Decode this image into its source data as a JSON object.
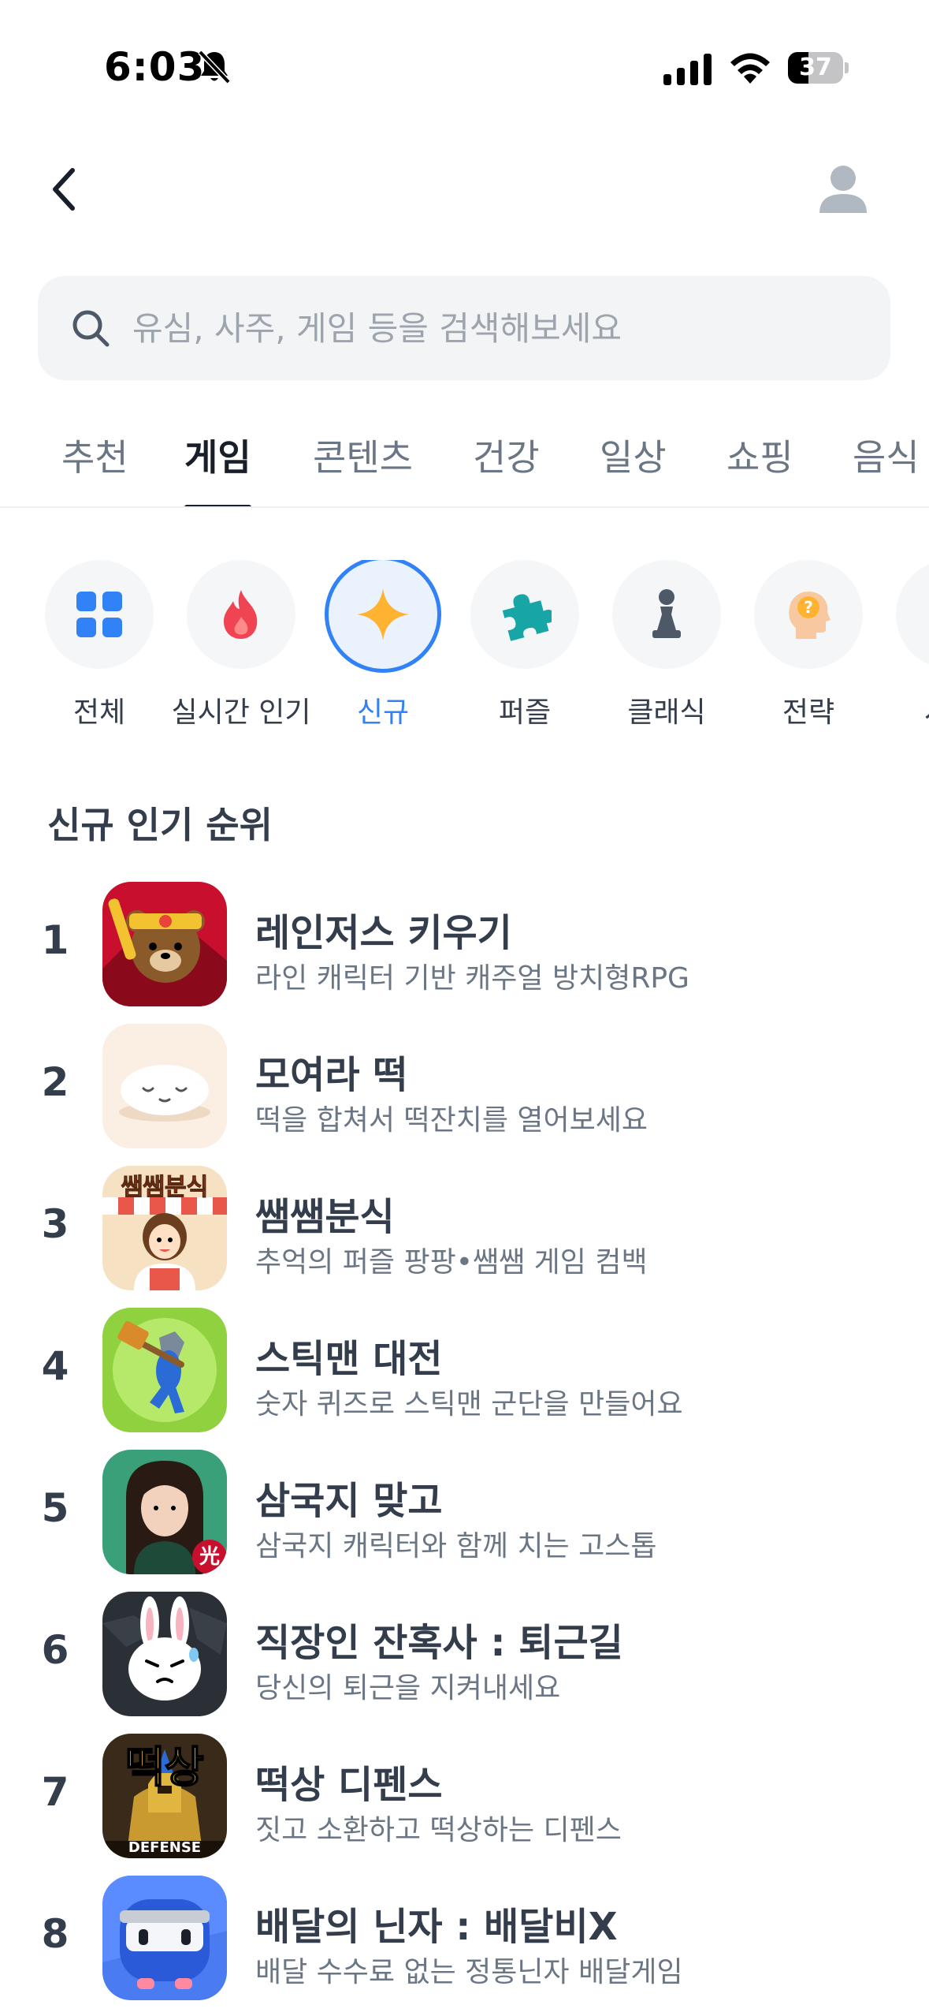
{
  "status_bar": {
    "time": "6:03",
    "battery": "37",
    "battery_level": 0.37
  },
  "search": {
    "placeholder": "유심, 사주, 게임 등을 검색해보세요"
  },
  "tabs": [
    {
      "label": "추천"
    },
    {
      "label": "게임",
      "active": true
    },
    {
      "label": "콘텐츠"
    },
    {
      "label": "건강"
    },
    {
      "label": "일상"
    },
    {
      "label": "쇼핑"
    },
    {
      "label": "음식"
    }
  ],
  "categories": [
    {
      "label": "전체",
      "icon": "grid-icon"
    },
    {
      "label": "실시간 인기",
      "icon": "fire-icon"
    },
    {
      "label": "신규",
      "icon": "sparkle-icon",
      "active": true
    },
    {
      "label": "퍼즐",
      "icon": "puzzle-icon"
    },
    {
      "label": "클래식",
      "icon": "chess-pawn-icon"
    },
    {
      "label": "전략",
      "icon": "head-question-icon"
    },
    {
      "label": "시뮬",
      "icon": "partial-icon"
    }
  ],
  "section": {
    "title": "신규 인기 순위"
  },
  "ranking": [
    {
      "rank": "1",
      "name": "레인저스 키우기",
      "desc": "라인 캐릭터 기반 캐주얼 방치형RPG",
      "icon": "bear-warrior-icon"
    },
    {
      "rank": "2",
      "name": "모여라 떡",
      "desc": "떡을 합쳐서 떡잔치를 열어보세요",
      "icon": "rice-cake-icon"
    },
    {
      "rank": "3",
      "name": "쌤쌤분식",
      "desc": "추억의 퍼즐 팡팡•쌤쌤 게임 컴백",
      "icon": "snack-shop-icon",
      "icon_text": "쌤쌤분식"
    },
    {
      "rank": "4",
      "name": "스틱맨 대전",
      "desc": "숫자 퀴즈로 스틱맨 군단을 만들어요",
      "icon": "stickman-hammer-icon"
    },
    {
      "rank": "5",
      "name": "삼국지 맞고",
      "desc": "삼국지 캐릭터와 함께 치는 고스톱",
      "icon": "three-kingdoms-icon",
      "icon_text": "光"
    },
    {
      "rank": "6",
      "name": "직장인 잔혹사 : 퇴근길",
      "desc": "당신의 퇴근을 지켜내세요",
      "icon": "rabbit-icon"
    },
    {
      "rank": "7",
      "name": "떡상 디펜스",
      "desc": "짓고 소환하고 떡상하는 디펜스",
      "icon": "warrior-defense-icon",
      "icon_text": "떡상",
      "icon_subtext": "DEFENSE"
    },
    {
      "rank": "8",
      "name": "배달의 닌자 :  배달비X",
      "desc": "배달 수수료 없는 정통닌자 배달게임",
      "icon": "ninja-icon"
    }
  ]
}
